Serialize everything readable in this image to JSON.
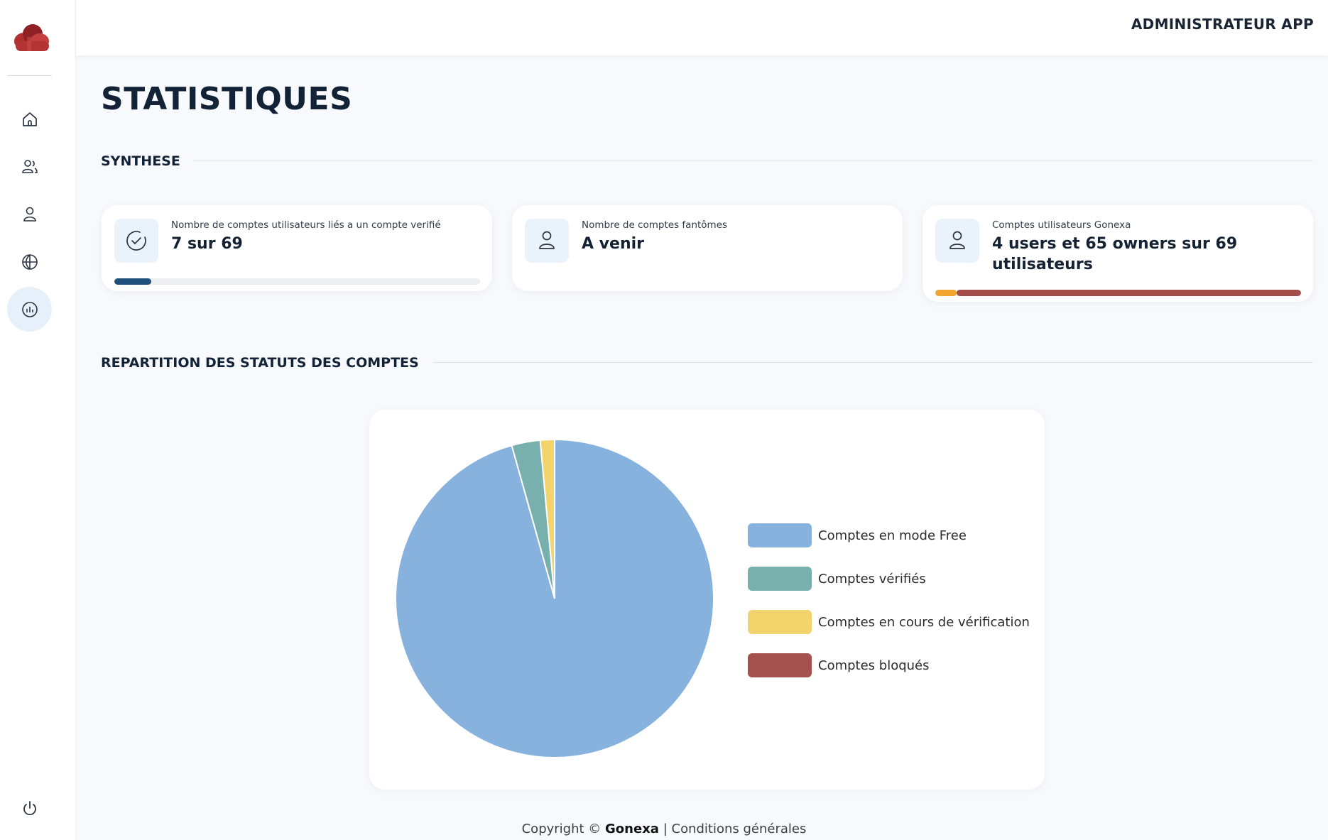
{
  "header": {
    "user_label": "ADMINISTRATEUR APP"
  },
  "sidebar": {
    "items": [
      {
        "name": "home",
        "icon": "home-icon",
        "active": false
      },
      {
        "name": "users",
        "icon": "users-icon",
        "active": false
      },
      {
        "name": "user",
        "icon": "user-icon",
        "active": false
      },
      {
        "name": "globe",
        "icon": "globe-icon",
        "active": false
      },
      {
        "name": "statistics",
        "icon": "chart-icon",
        "active": true
      }
    ],
    "logout_icon": "power-icon"
  },
  "page": {
    "title": "STATISTIQUES"
  },
  "synthese": {
    "title": "SYNTHESE",
    "cards": [
      {
        "icon": "check-circle-icon",
        "label": "Nombre de comptes utilisateurs liés a un compte verifié",
        "value": "7  sur 69",
        "progress": 0.1,
        "progress_color": "#1f4e7a"
      },
      {
        "icon": "user-icon",
        "label": "Nombre de comptes fantômes",
        "value": "A venir"
      },
      {
        "icon": "user-icon",
        "label": "Comptes utilisateurs Gonexa",
        "value": "4 users et 65 owners sur 69 utilisateurs",
        "progress_segments": [
          {
            "fraction": 0.058,
            "color": "#f2a531"
          },
          {
            "fraction": 0.942,
            "color": "#a34d48"
          }
        ]
      }
    ]
  },
  "repartition": {
    "title": "REPARTITION DES STATUTS DES COMPTES"
  },
  "chart_data": {
    "type": "pie",
    "categories": [
      "Comptes en mode Free",
      "Comptes vérifiés",
      "Comptes en cours de vérification",
      "Comptes bloqués"
    ],
    "values": [
      66,
      2,
      1,
      0
    ],
    "colors": [
      "#87b2dd",
      "#78b0ad",
      "#f3d36c",
      "#a5524e"
    ]
  },
  "footer": {
    "copyright": "Copyright ©",
    "brand": "Gonexa",
    "separator": "|",
    "terms": "Conditions générales"
  }
}
